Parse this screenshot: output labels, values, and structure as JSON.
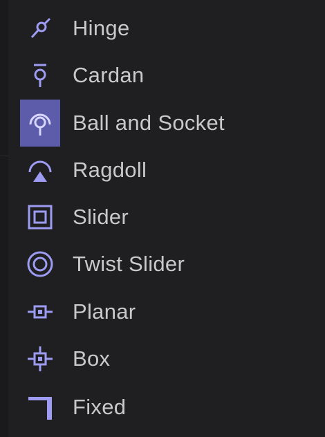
{
  "accent_color": "#9e9cf2",
  "selection_color": "#5d5cab",
  "menu": {
    "items": [
      {
        "label": "Hinge",
        "icon": "hinge-icon",
        "selected": false
      },
      {
        "label": "Cardan",
        "icon": "cardan-icon",
        "selected": false
      },
      {
        "label": "Ball and Socket",
        "icon": "ball-and-socket-icon",
        "selected": true
      },
      {
        "label": "Ragdoll",
        "icon": "ragdoll-icon",
        "selected": false
      },
      {
        "label": "Slider",
        "icon": "slider-icon",
        "selected": false
      },
      {
        "label": "Twist Slider",
        "icon": "twist-slider-icon",
        "selected": false
      },
      {
        "label": "Planar",
        "icon": "planar-icon",
        "selected": false
      },
      {
        "label": "Box",
        "icon": "box-icon",
        "selected": false
      },
      {
        "label": "Fixed",
        "icon": "fixed-icon",
        "selected": false
      }
    ]
  }
}
